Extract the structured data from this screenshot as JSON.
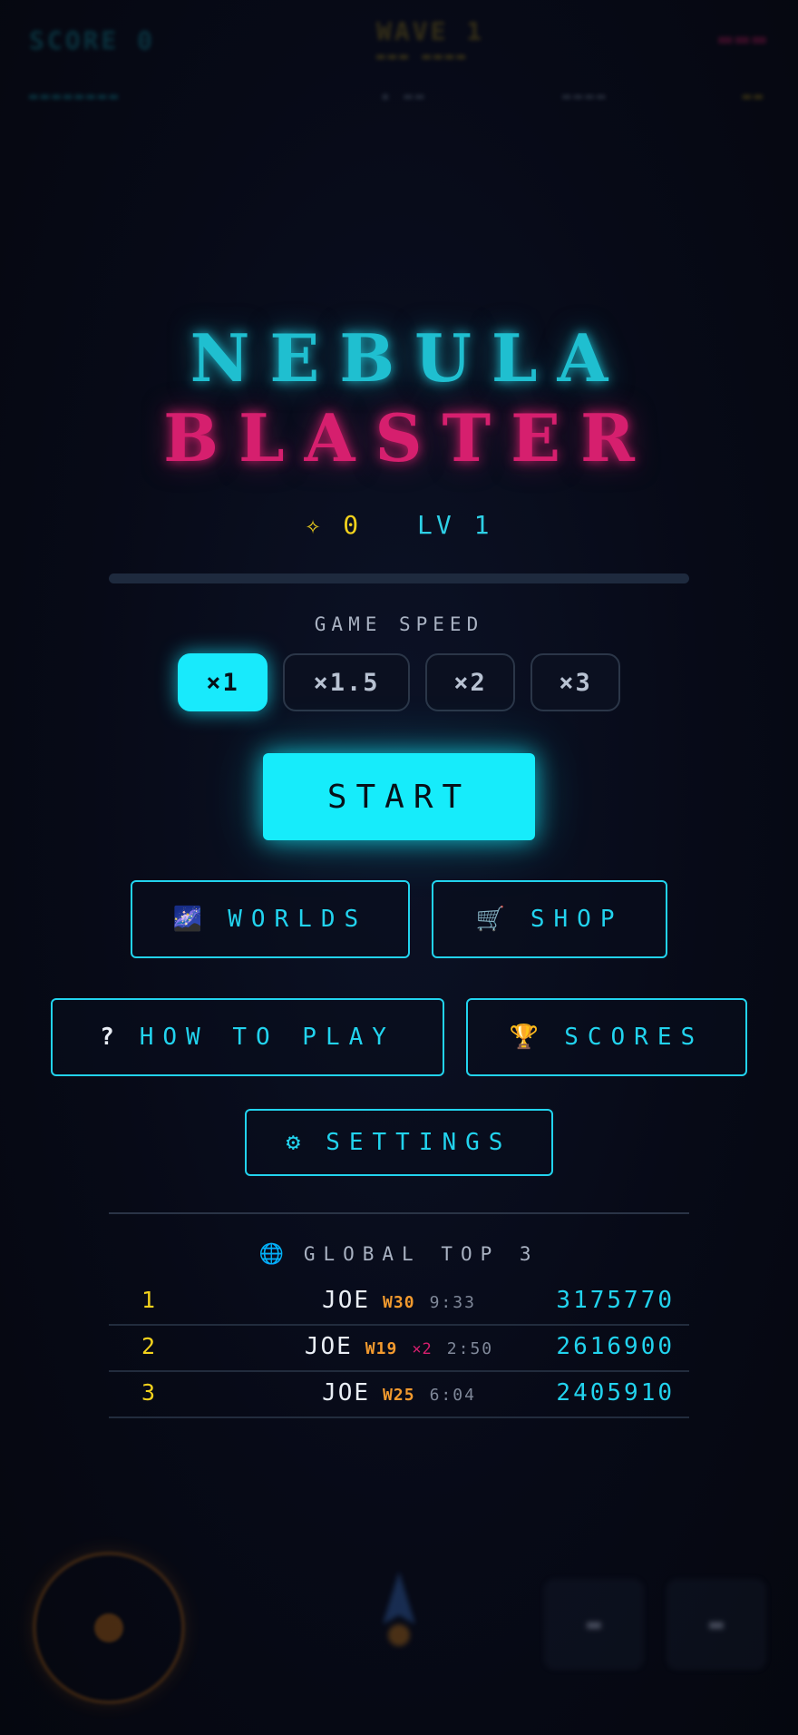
{
  "title": {
    "line1": "NEBULA",
    "line2": "BLASTER"
  },
  "stats": {
    "coins": "✧ 0",
    "level": "LV 1",
    "xp_fraction": 0
  },
  "speed": {
    "label": "GAME SPEED",
    "options": [
      "×1",
      "×1.5",
      "×2",
      "×3"
    ],
    "selected": "×1"
  },
  "start_label": "START",
  "menu": {
    "worlds": {
      "icon": "🌌",
      "label": "WORLDS"
    },
    "shop": {
      "icon": "🛒",
      "label": "SHOP"
    },
    "how_to_play": {
      "icon": "?",
      "label": "HOW TO PLAY"
    },
    "scores": {
      "icon": "🏆",
      "label": "SCORES"
    },
    "settings": {
      "icon": "⚙",
      "label": "SETTINGS"
    }
  },
  "leaderboard": {
    "icon": "🌐",
    "title": "GLOBAL TOP 3",
    "rows": [
      {
        "rank": "1",
        "name": "JOE",
        "wave": "W30",
        "mult": "",
        "time": "9:33",
        "score": "3175770"
      },
      {
        "rank": "2",
        "name": "JOE",
        "wave": "W19",
        "mult": "×2",
        "time": "2:50",
        "score": "2616900"
      },
      {
        "rank": "3",
        "name": "JOE",
        "wave": "W25",
        "mult": "",
        "time": "6:04",
        "score": "2405910"
      }
    ]
  },
  "colors": {
    "accent_cyan": "#22d3ee",
    "accent_pink": "#d61f6e",
    "accent_yellow": "#f3d21c",
    "accent_orange": "#f29a2e"
  }
}
